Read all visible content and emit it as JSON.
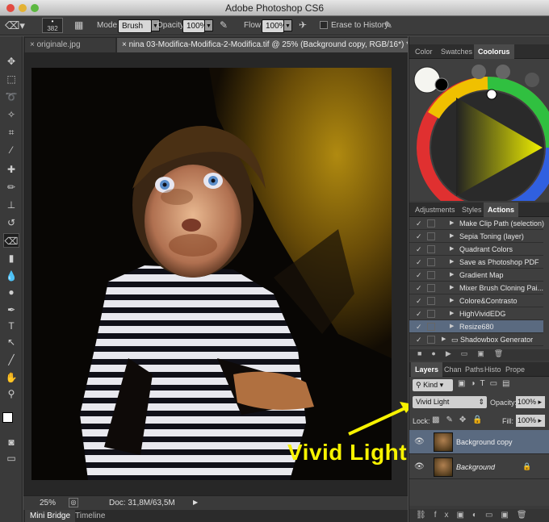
{
  "app": {
    "title": "Adobe Photoshop CS6"
  },
  "options_bar": {
    "brush_size": "382",
    "mode_label": "Mode:",
    "mode_value": "Brush",
    "opacity_label": "Opacity:",
    "opacity_value": "100%",
    "flow_label": "Flow:",
    "flow_value": "100%",
    "erase_history_label": "Erase to History"
  },
  "documents": {
    "tabs": [
      {
        "label": "originale.jpg"
      },
      {
        "label": "nina 03-Modifica-Modifica-2-Modifica.tif @ 25% (Background copy, RGB/16*) *"
      }
    ]
  },
  "status": {
    "zoom": "25%",
    "doc_info": "Doc: 31,8M/63,5M"
  },
  "bottom_tabs": [
    {
      "label": "Mini Bridge"
    },
    {
      "label": "Timeline"
    }
  ],
  "color_panel": {
    "tabs": [
      "Color",
      "Swatches",
      "Coolorus"
    ],
    "active": "Coolorus"
  },
  "actions_panel": {
    "tabs": [
      "Adjustments",
      "Styles",
      "Actions"
    ],
    "active": "Actions",
    "items": [
      {
        "label": "Make Clip Path (selection)"
      },
      {
        "label": "Sepia Toning (layer)"
      },
      {
        "label": "Quadrant Colors"
      },
      {
        "label": "Save as Photoshop PDF"
      },
      {
        "label": "Gradient Map"
      },
      {
        "label": "Mixer Brush Cloning Pai..."
      },
      {
        "label": "Colore&Contrasto"
      },
      {
        "label": "HighVividEDG"
      },
      {
        "label": "Resize680"
      },
      {
        "label": "Shadowbox Generator"
      }
    ]
  },
  "layers_panel": {
    "tabs": [
      "Layers",
      "Chan",
      "Paths",
      "Histo",
      "Prope"
    ],
    "active": "Layers",
    "kind_label": "Kind",
    "blend_mode": "Vivid Light",
    "opacity_label": "Opacity:",
    "opacity_value": "100%",
    "lock_label": "Lock:",
    "fill_label": "Fill:",
    "fill_value": "100%",
    "layers": [
      {
        "name": "Background copy"
      },
      {
        "name": "Background"
      }
    ]
  },
  "annotation": {
    "text": "Vivid Light",
    "color": "#f7f200"
  }
}
